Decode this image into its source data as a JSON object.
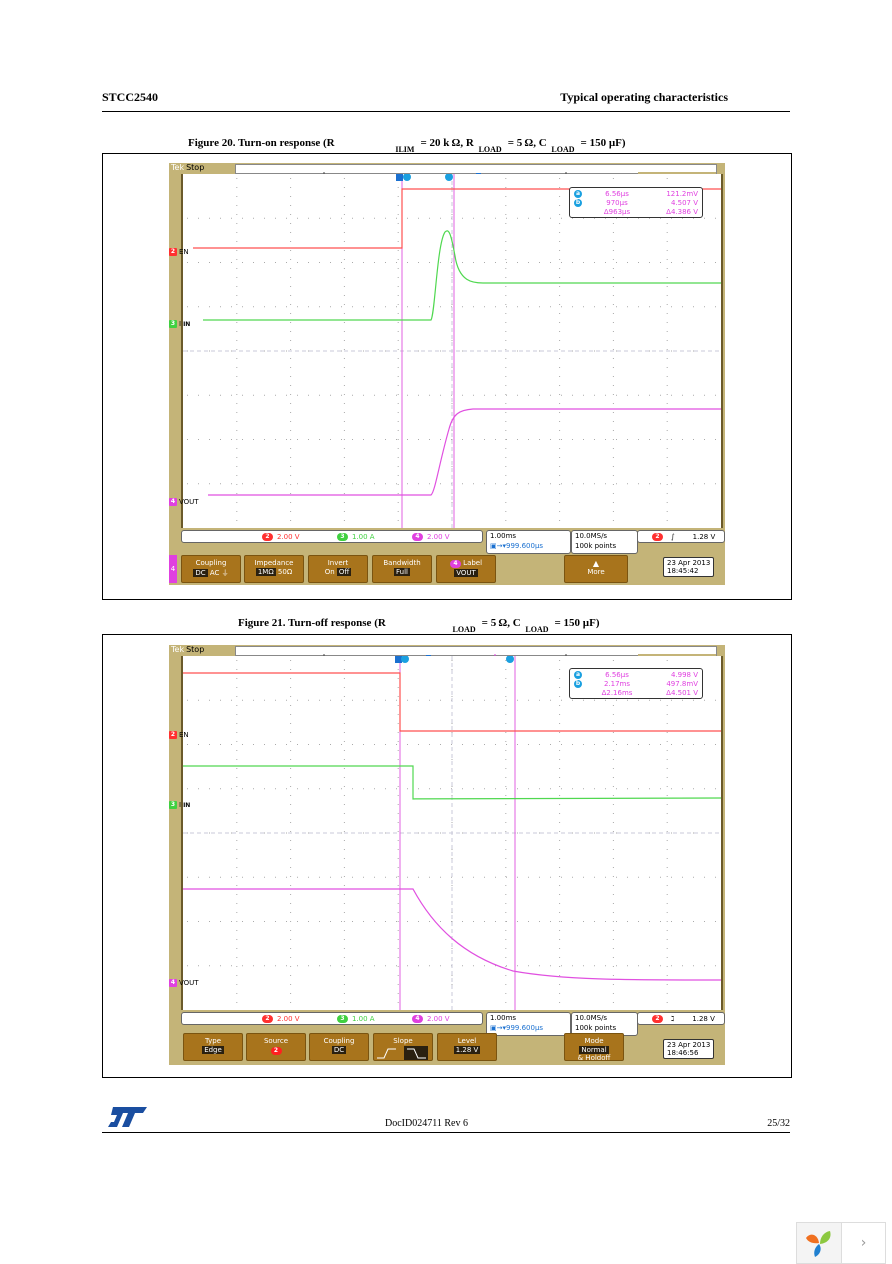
{
  "header": {
    "left": "STCC2540",
    "right": "Typical operating characteristics"
  },
  "footer": {
    "doc_id": "DocID024711 Rev 6",
    "page": "25/32",
    "logo": "st-logo"
  },
  "figures": [
    {
      "caption": {
        "main": "Figure 20. Turn-on response (R",
        "sub1": "ILIM",
        "p1": "= 20 k Ω, R",
        "sub2": "LOAD",
        "p2": "= 5 Ω, C",
        "sub3": "LOAD",
        "p3": "= 150 µF)"
      },
      "scope": {
        "brand": "Tek",
        "state": "Stop",
        "channels": [
          {
            "num": "2",
            "label": "EN",
            "color": "#ff3030"
          },
          {
            "num": "3",
            "label": "I",
            "label_sub": "IN",
            "color": "#40d040"
          },
          {
            "num": "4",
            "label": "VOUT",
            "color": "#e040e0"
          }
        ],
        "cursors": {
          "a": {
            "time": "6.56µs",
            "value": "121.2mV"
          },
          "b": {
            "time": "970µs",
            "value": "4.507 V"
          },
          "delta": {
            "time": "Δ963µs",
            "value": "Δ4.386 V"
          }
        },
        "scales": [
          {
            "num": "2",
            "value": "2.00 V",
            "color": "#ff3030"
          },
          {
            "num": "3",
            "value": "1.00 A",
            "color": "#40d040"
          },
          {
            "num": "4",
            "value": "2.00 V",
            "color": "#e040e0"
          }
        ],
        "timebase": "1.00ms",
        "trigger_pos": "999.600µs",
        "sample_rate": "10.0MS/s",
        "record": "100k points",
        "trigger": {
          "source": "2",
          "slope": "rising",
          "level": "1.28 V"
        },
        "date": "23 Apr  2013",
        "time": "18:45:42",
        "menu_side": "4",
        "menu": [
          {
            "title": "Coupling",
            "options": [
              "DC",
              "AC",
              "⏚"
            ],
            "selected": 0
          },
          {
            "title": "Impedance",
            "options": [
              "1MΩ",
              "50Ω"
            ],
            "selected": 0
          },
          {
            "title": "Invert",
            "options": [
              "On",
              "Off"
            ],
            "selected": 1
          },
          {
            "title": "Bandwidth",
            "value": "Full"
          },
          {
            "title": "Label",
            "title_badge": "4",
            "value": "VOUT"
          },
          {
            "title": "More",
            "icon": "up-arrow"
          }
        ]
      }
    },
    {
      "caption": {
        "main": "Figure 21. Turn-off response (R",
        "sub2": "LOAD",
        "p2": "= 5 Ω, C",
        "sub3": "LOAD",
        "p3": "= 150 µF)"
      },
      "scope": {
        "brand": "Tek",
        "state": "Stop",
        "channels": [
          {
            "num": "2",
            "label": "EN",
            "color": "#ff3030"
          },
          {
            "num": "3",
            "label": "I",
            "label_sub": "IN",
            "color": "#40d040"
          },
          {
            "num": "4",
            "label": "VOUT",
            "color": "#e040e0"
          }
        ],
        "cursors": {
          "a": {
            "time": "6.56µs",
            "value": "4.998 V"
          },
          "b": {
            "time": "2.17ms",
            "value": "497.8mV"
          },
          "delta": {
            "time": "Δ2.16ms",
            "value": "Δ4.501 V"
          }
        },
        "scales": [
          {
            "num": "2",
            "value": "2.00 V",
            "color": "#ff3030"
          },
          {
            "num": "3",
            "value": "1.00 A",
            "color": "#40d040"
          },
          {
            "num": "4",
            "value": "2.00 V",
            "color": "#e040e0"
          }
        ],
        "timebase": "1.00ms",
        "trigger_pos": "999.600µs",
        "sample_rate": "10.0MS/s",
        "record": "100k points",
        "trigger": {
          "source": "2",
          "slope": "falling",
          "level": "1.28 V"
        },
        "date": "23 Apr  2013",
        "time": "18:46:56",
        "menu": [
          {
            "title": "Type",
            "value": "Edge"
          },
          {
            "title": "Source",
            "badge": "2"
          },
          {
            "title": "Coupling",
            "value": "DC"
          },
          {
            "title": "Slope",
            "options": [
              "rising",
              "falling"
            ],
            "selected": 1
          },
          {
            "title": "Level",
            "value": "1.28 V"
          },
          {
            "title": "Mode",
            "value": "Normal",
            "value2": "& Holdoff"
          }
        ]
      }
    }
  ]
}
